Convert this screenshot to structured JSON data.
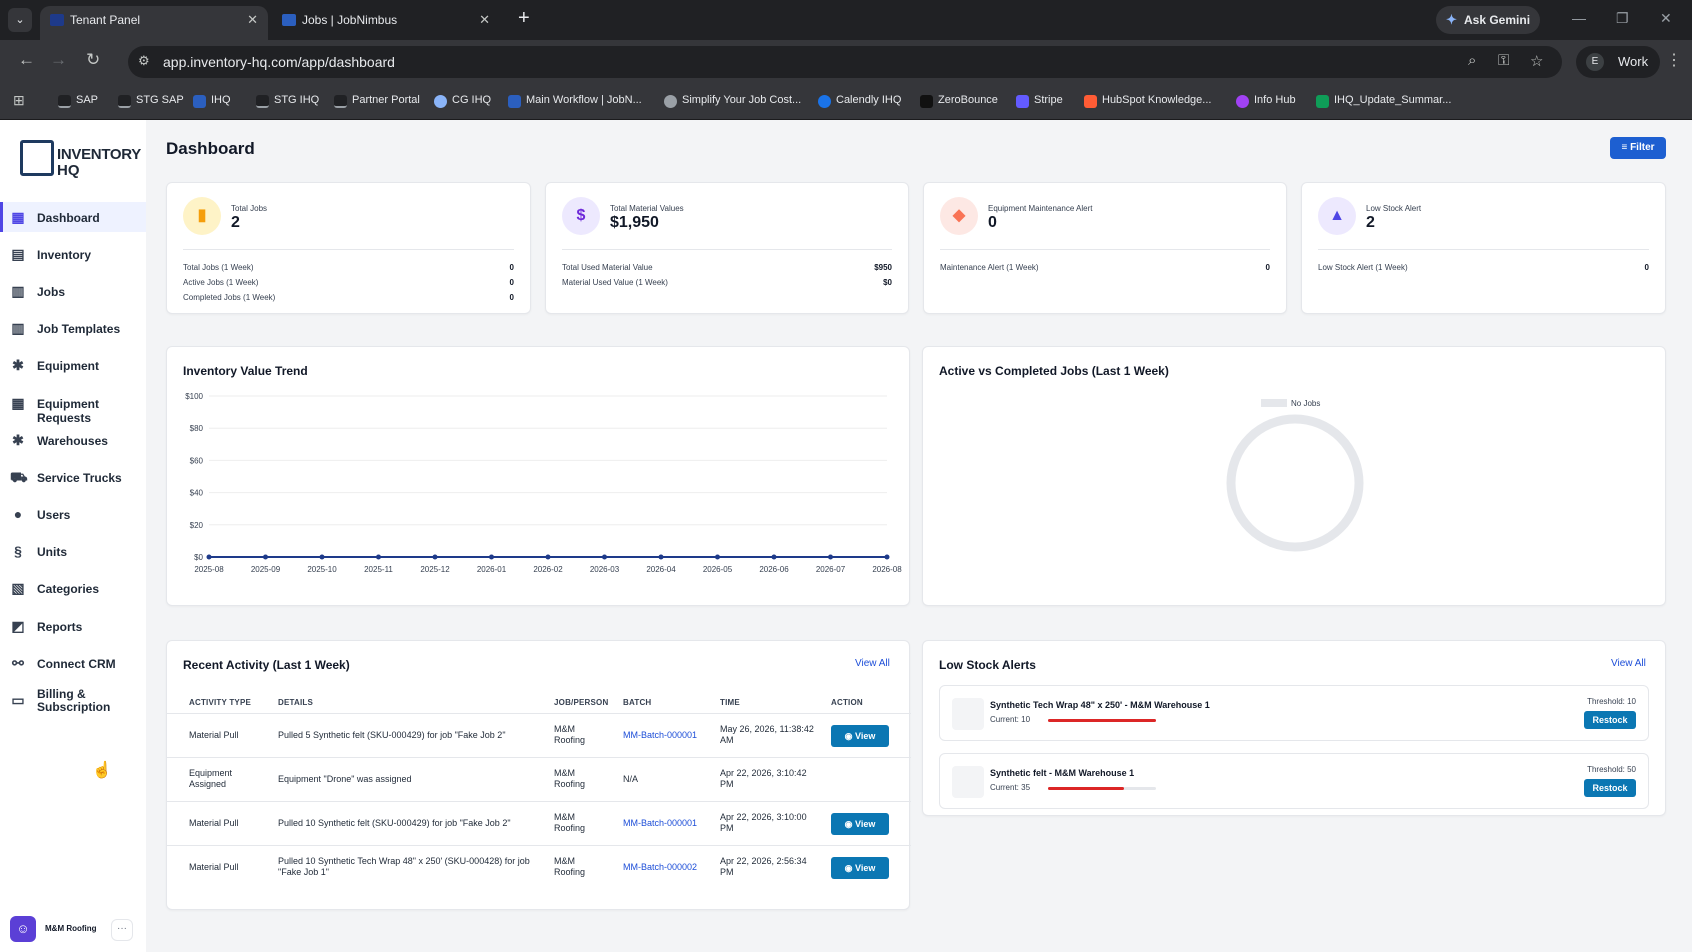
{
  "browser": {
    "tabs": [
      {
        "title": "Tenant Panel",
        "active": true
      },
      {
        "title": "Jobs | JobNimbus",
        "active": false
      }
    ],
    "gemini_label": "Ask Gemini",
    "url": "app.inventory-hq.com/app/dashboard",
    "profile_initial": "E",
    "profile_label": "Work",
    "bookmarks": [
      "SAP",
      "STG SAP",
      "IHQ",
      "STG IHQ",
      "Partner Portal",
      "CG IHQ",
      "Main Workflow | JobN...",
      "Simplify Your Job Cost...",
      "Calendly IHQ",
      "ZeroBounce",
      "Stripe",
      "HubSpot Knowledge...",
      "Info Hub",
      "IHQ_Update_Summar..."
    ]
  },
  "logo": {
    "line1": "INVENTORY",
    "line2": "HQ"
  },
  "sidebar": {
    "items": [
      {
        "label": "Dashboard",
        "icon": "grid-icon"
      },
      {
        "label": "Inventory",
        "icon": "boxes-icon"
      },
      {
        "label": "Jobs",
        "icon": "briefcase-icon"
      },
      {
        "label": "Job Templates",
        "icon": "template-icon"
      },
      {
        "label": "Equipment",
        "icon": "tools-icon"
      },
      {
        "label": "Equipment Requests",
        "icon": "request-icon"
      },
      {
        "label": "Warehouses",
        "icon": "warehouse-icon"
      },
      {
        "label": "Service Trucks",
        "icon": "truck-icon"
      },
      {
        "label": "Users",
        "icon": "users-icon"
      },
      {
        "label": "Units",
        "icon": "units-icon"
      },
      {
        "label": "Categories",
        "icon": "categories-icon"
      },
      {
        "label": "Reports",
        "icon": "reports-icon"
      },
      {
        "label": "Connect CRM",
        "icon": "connect-icon"
      },
      {
        "label": "Billing & Subscription",
        "icon": "billing-icon"
      }
    ],
    "user_name": "M&M Roofing",
    "more": "···"
  },
  "header": {
    "title": "Dashboard",
    "filter_label": "Filter"
  },
  "stats": [
    {
      "label": "Total Jobs",
      "value": "2",
      "icon": "briefcase-icon",
      "rows": [
        {
          "label": "Total Jobs (1 Week)",
          "value": "0"
        },
        {
          "label": "Active Jobs (1 Week)",
          "value": "0"
        },
        {
          "label": "Completed Jobs (1 Week)",
          "value": "0"
        }
      ]
    },
    {
      "label": "Total Material Values",
      "value": "$1,950",
      "icon": "dollar-icon",
      "icon_char": "$",
      "rows": [
        {
          "label": "Total Used Material Value",
          "value": "$950"
        },
        {
          "label": "Material Used Value (1 Week)",
          "value": "$0"
        }
      ]
    },
    {
      "label": "Equipment Maintenance Alert",
      "value": "0",
      "icon": "bag-icon",
      "rows": [
        {
          "label": "Maintenance Alert (1 Week)",
          "value": "0"
        }
      ]
    },
    {
      "label": "Low Stock Alert",
      "value": "2",
      "icon": "warning-icon",
      "rows": [
        {
          "label": "Low Stock Alert (1 Week)",
          "value": "0"
        }
      ]
    }
  ],
  "chart_data": [
    {
      "type": "line",
      "title": "Inventory Value Trend",
      "x": [
        "2025-08",
        "2025-09",
        "2025-10",
        "2025-11",
        "2025-12",
        "2026-01",
        "2026-02",
        "2026-03",
        "2026-04",
        "2026-05",
        "2026-06",
        "2026-07",
        "2026-08"
      ],
      "values": [
        0,
        0,
        0,
        0,
        0,
        0,
        0,
        0,
        0,
        0,
        0,
        0,
        0
      ],
      "y_ticks": [
        "$100",
        "$80",
        "$60",
        "$40",
        "$20",
        "$0"
      ],
      "ylim": [
        0,
        100
      ],
      "grid": true,
      "color": "#1e3a8a"
    },
    {
      "type": "pie",
      "title": "Active vs Completed Jobs (Last 1 Week)",
      "legend": [
        "No Jobs"
      ],
      "values": [
        1
      ],
      "color": "#e5e7eb"
    }
  ],
  "activity": {
    "title": "Recent Activity (Last 1 Week)",
    "view_all": "View All",
    "columns": [
      "Activity Type",
      "Details",
      "Job/Person",
      "Batch",
      "Time",
      "Action"
    ],
    "rows": [
      {
        "type": "Material Pull",
        "details": "Pulled 5 Synthetic felt (SKU-000429) for job \"Fake Job 2\"",
        "person": "M&M Roofing",
        "batch": "MM-Batch-000001",
        "time": "May 26, 2026, 11:38:42 AM",
        "action": "View"
      },
      {
        "type": "Equipment Assigned",
        "details": "Equipment \"Drone\" was assigned",
        "person": "M&M Roofing",
        "batch": "N/A",
        "time": "Apr 22, 2026, 3:10:42 PM",
        "action": ""
      },
      {
        "type": "Material Pull",
        "details": "Pulled 10 Synthetic felt (SKU-000429) for job \"Fake Job 2\"",
        "person": "M&M Roofing",
        "batch": "MM-Batch-000001",
        "time": "Apr 22, 2026, 3:10:00 PM",
        "action": "View"
      },
      {
        "type": "Material Pull",
        "details": "Pulled 10 Synthetic Tech Wrap 48\" x 250' (SKU-000428) for job \"Fake Job 1\"",
        "person": "M&M Roofing",
        "batch": "MM-Batch-000002",
        "time": "Apr 22, 2026, 2:56:34 PM",
        "action": "View"
      }
    ]
  },
  "low_stock": {
    "title": "Low Stock Alerts",
    "view_all": "View All",
    "items": [
      {
        "name": "Synthetic Tech Wrap 48\" x 250' - M&M Warehouse 1",
        "current": "Current: 10",
        "threshold": "Threshold: 10",
        "level": 1.0,
        "action": "Restock"
      },
      {
        "name": "Synthetic felt - M&M Warehouse 1",
        "current": "Current: 35",
        "threshold": "Threshold: 50",
        "level": 0.7,
        "action": "Restock"
      }
    ]
  }
}
